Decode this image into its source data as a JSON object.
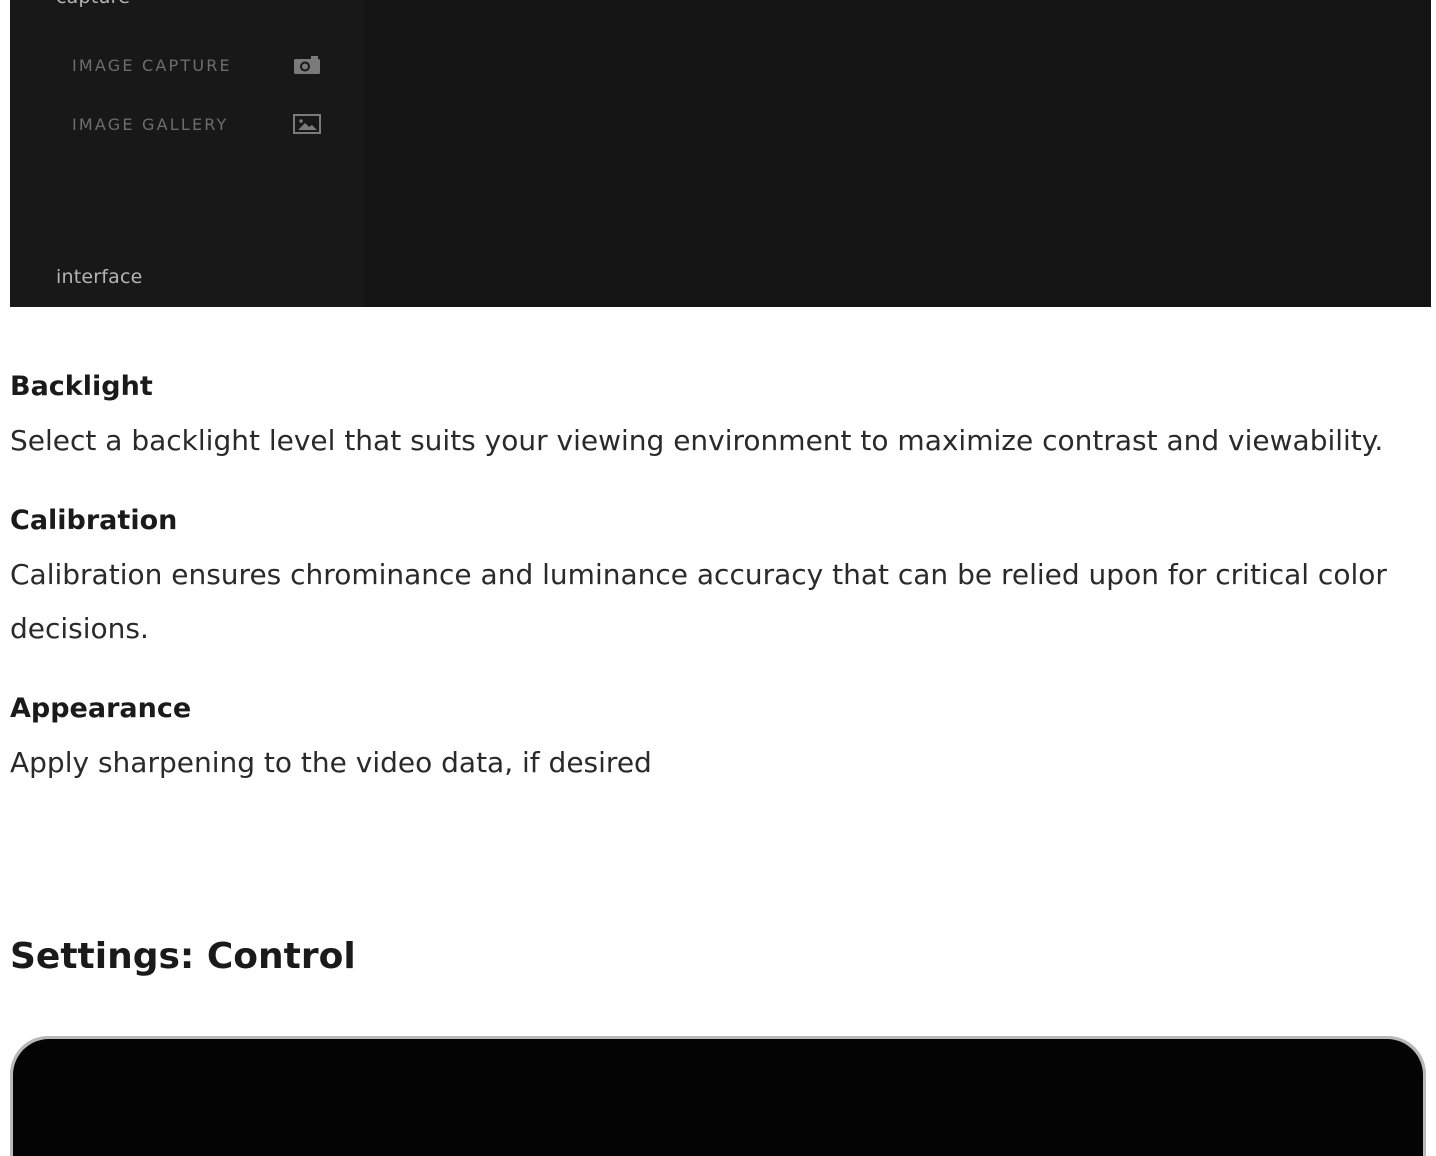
{
  "device_top": {
    "section_capture": "capture",
    "section_interface": "interface",
    "menu": [
      {
        "label": "IMAGE CAPTURE",
        "icon": "camera-icon"
      },
      {
        "label": "IMAGE GALLERY",
        "icon": "image-icon"
      }
    ]
  },
  "features": [
    {
      "title": "Backlight",
      "description": "Select a backlight level that suits your viewing environment to maximize contrast and viewability."
    },
    {
      "title": "Calibration",
      "description": "Calibration ensures chrominance and luminance accuracy that can be relied upon for critical color decisions."
    },
    {
      "title": "Appearance",
      "description": "Apply sharpening to the video data, if desired"
    }
  ],
  "section_heading": "Settings: Control"
}
